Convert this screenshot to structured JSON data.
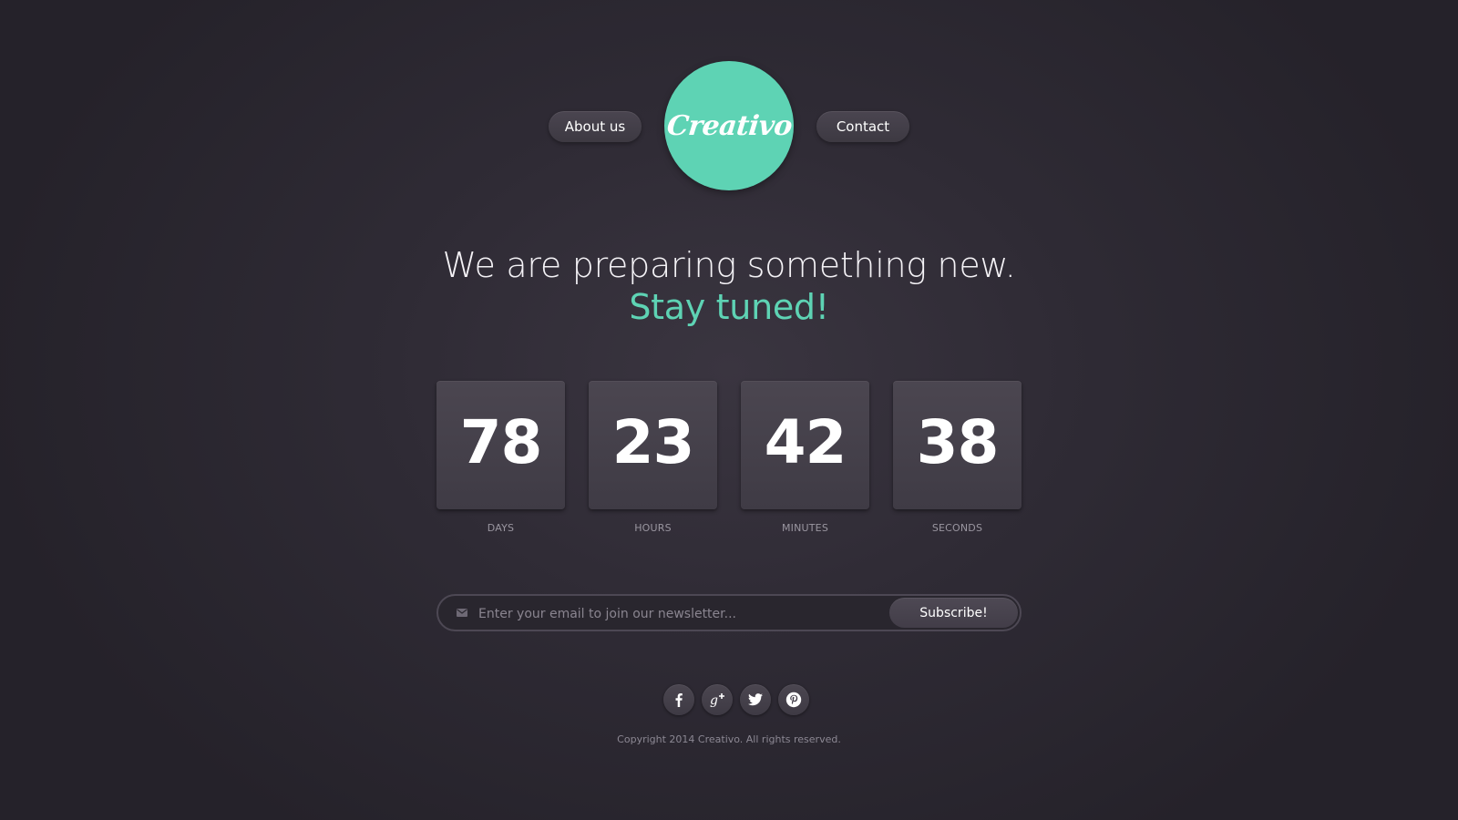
{
  "nav": {
    "about_label": "About us",
    "contact_label": "Contact",
    "logo_text": "Creativo"
  },
  "hero": {
    "headline": "We are preparing something new.",
    "tagline": "Stay tuned!"
  },
  "countdown": [
    {
      "value": "78",
      "label": "DAYS"
    },
    {
      "value": "23",
      "label": "HOURS"
    },
    {
      "value": "42",
      "label": "MINUTES"
    },
    {
      "value": "38",
      "label": "SECONDS"
    }
  ],
  "newsletter": {
    "placeholder": "Enter your email to join our newsletter...",
    "value": "",
    "button_label": "Subscribe!",
    "icon": "mail-icon"
  },
  "social": [
    {
      "name": "facebook-icon"
    },
    {
      "name": "google-plus-icon"
    },
    {
      "name": "twitter-icon"
    },
    {
      "name": "pinterest-icon"
    }
  ],
  "footer": {
    "copyright": "Copyright 2014 Creativo. All rights reserved."
  },
  "colors": {
    "accent": "#5ed3b4",
    "background": "#2f2b35",
    "tile": "#46414b"
  }
}
